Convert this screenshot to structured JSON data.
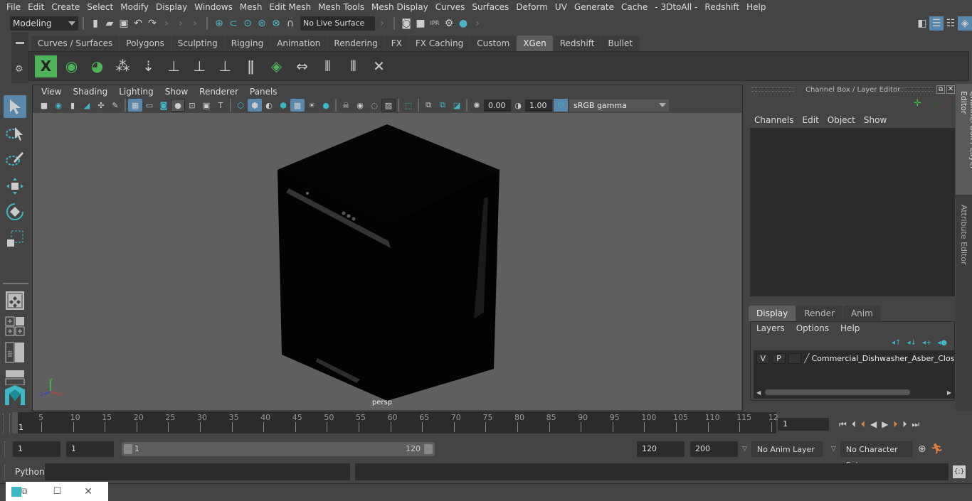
{
  "menubar": [
    "File",
    "Edit",
    "Create",
    "Select",
    "Modify",
    "Display",
    "Windows",
    "Mesh",
    "Edit Mesh",
    "Mesh Tools",
    "Mesh Display",
    "Curves",
    "Surfaces",
    "Deform",
    "UV",
    "Generate",
    "Cache",
    "- 3DtoAll -",
    "Redshift",
    "Help"
  ],
  "status": {
    "mode": "Modeling",
    "live_surface": "No Live Surface"
  },
  "shelf_tabs": [
    {
      "label": "Curves / Surfaces",
      "active": false
    },
    {
      "label": "Polygons",
      "active": false
    },
    {
      "label": "Sculpting",
      "active": false
    },
    {
      "label": "Rigging",
      "active": false
    },
    {
      "label": "Animation",
      "active": false
    },
    {
      "label": "Rendering",
      "active": false
    },
    {
      "label": "FX",
      "active": false
    },
    {
      "label": "FX Caching",
      "active": false
    },
    {
      "label": "Custom",
      "active": false
    },
    {
      "label": "XGen",
      "active": true
    },
    {
      "label": "Redshift",
      "active": false
    },
    {
      "label": "Bullet",
      "active": false
    }
  ],
  "shelf_icons": [
    "xgen-editor-icon",
    "xgen-preview-icon",
    "xgen-hide-preview-icon",
    "create-description-icon",
    "place-guides-icon",
    "add-guide-icon",
    "show-guides-icon",
    "lock-guides-icon",
    "split-guides-icon",
    "guide-tangent-icon",
    "flip-guides-icon",
    "select-guides-icon",
    "guide-cvs-icon",
    "delete-guides-icon"
  ],
  "viewport": {
    "menu": [
      "View",
      "Shading",
      "Lighting",
      "Show",
      "Renderer",
      "Panels"
    ],
    "exposure": "0.00",
    "gamma": "1.00",
    "color_space": "sRGB gamma",
    "camera_label": "persp",
    "axis": {
      "x": "x",
      "y": "y",
      "z": "z"
    }
  },
  "channel_box": {
    "title": "Channel Box / Layer Editor",
    "menu": [
      "Channels",
      "Edit",
      "Object",
      "Show"
    ],
    "layer_tabs": [
      {
        "label": "Display",
        "active": true
      },
      {
        "label": "Render",
        "active": false
      },
      {
        "label": "Anim",
        "active": false
      }
    ],
    "layer_menu": [
      "Layers",
      "Options",
      "Help"
    ],
    "layers": [
      {
        "v": "V",
        "p": "P",
        "name": "Commercial_Dishwasher_Asber_Close"
      }
    ]
  },
  "side_tabs": [
    "Channel Box / Layer Editor",
    "Attribute Editor"
  ],
  "timeline": {
    "ticks": [
      "5",
      "10",
      "15",
      "20",
      "25",
      "30",
      "35",
      "40",
      "45",
      "50",
      "55",
      "60",
      "65",
      "70",
      "75",
      "80",
      "85",
      "90",
      "95",
      "100",
      "105",
      "110",
      "115",
      "12"
    ],
    "current_marker": "1",
    "current_frame": "1"
  },
  "range": {
    "start": "1",
    "playback_start": "1",
    "slider_start": "1",
    "slider_end": "120",
    "playback_end": "120",
    "end": "200",
    "anim_layer": "No Anim Layer",
    "character_set": "No Character Set"
  },
  "command_line": {
    "label": "Python"
  },
  "colors": {
    "accent": "#5a87ac",
    "teal": "#3fb8c6",
    "xgen_green": "#4fb35a",
    "key_orange": "#e08040"
  }
}
